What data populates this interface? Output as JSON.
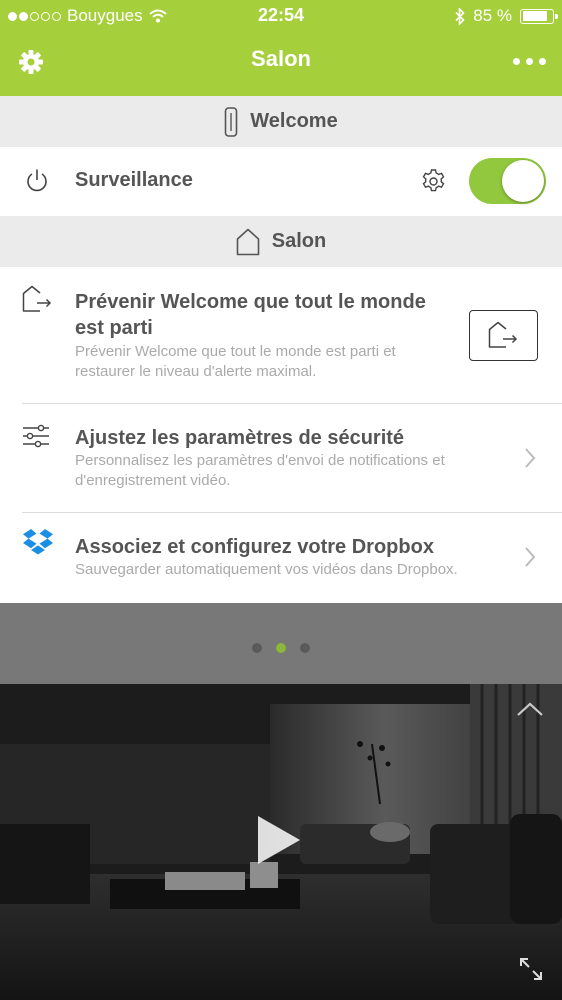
{
  "status_bar": {
    "carrier": "Bouygues",
    "time": "22:54",
    "battery": "85 %",
    "battery_level": 0.85,
    "signal_dots_filled": 2,
    "signal_dots_total": 5
  },
  "nav": {
    "title": "Salon",
    "left_icon": "gear-icon",
    "right_icon": "more-icon"
  },
  "sections": {
    "welcome_header": "Welcome",
    "salon_header": "Salon"
  },
  "surveillance": {
    "label": "Surveillance",
    "enabled": true
  },
  "items": [
    {
      "title": "Prévenir Welcome que tout le monde est parti",
      "subtitle": "Prévenir Welcome que tout le monde est parti et restaurer le niveau d'alerte maximal."
    },
    {
      "title": "Ajustez les paramètres de sécurité",
      "subtitle": "Personnalisez les paramètres d'envoi de notifications et d'enregistrement vidéo."
    },
    {
      "title": "Associez et configurez votre Dropbox",
      "subtitle": "Sauvegarder automatiquement vos vidéos dans Dropbox."
    }
  ],
  "pager": {
    "pages": 3,
    "current": 2
  },
  "colors": {
    "brand_green": "#a6cf3c",
    "toggle_green": "#92c83e",
    "dropbox_blue": "#1b8ee5",
    "page_dot_active": "#8ab83a"
  }
}
